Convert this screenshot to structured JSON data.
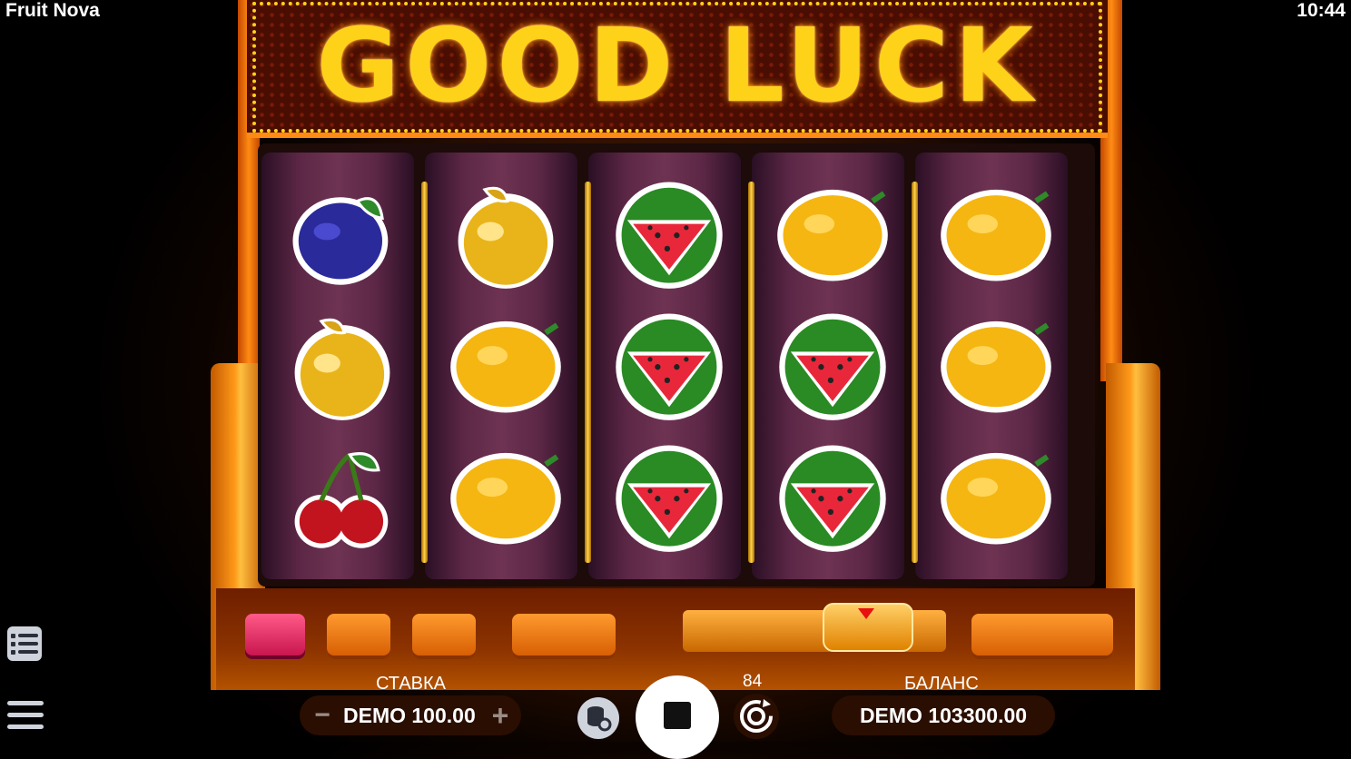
{
  "app": {
    "title": "Fruit Nova",
    "clock": "10:44"
  },
  "marquee": {
    "text": "GOOD LUCK"
  },
  "reels": [
    [
      "plum",
      "golden-apple",
      "cherry"
    ],
    [
      "golden-apple",
      "lemon",
      "lemon"
    ],
    [
      "watermelon",
      "watermelon",
      "watermelon"
    ],
    [
      "lemon",
      "watermelon",
      "watermelon"
    ],
    [
      "lemon",
      "lemon",
      "lemon"
    ]
  ],
  "bet": {
    "label": "СТАВКА",
    "value": "DEMO 100.00",
    "minus": "−",
    "plus": "+"
  },
  "balance": {
    "label": "БАЛАНС",
    "value": "DEMO 103300.00"
  },
  "autospin": {
    "count": "84"
  },
  "colors": {
    "accent": "#ff9a1a",
    "marquee_lights": "#ffd21a",
    "reel_bg": "#5c2746"
  }
}
